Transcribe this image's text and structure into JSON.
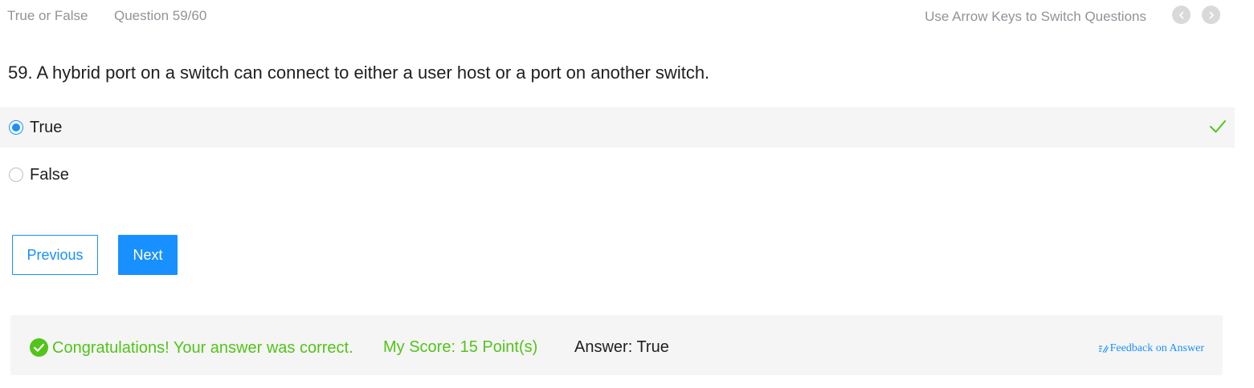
{
  "header": {
    "question_type": "True or False",
    "progress": "Question 59/60",
    "hint": "Use Arrow Keys to Switch Questions",
    "prev_icon": "chevron-left-icon",
    "next_icon": "chevron-right-icon"
  },
  "question": {
    "text": "59. A hybrid port on a switch can connect to either a user host or a port on another switch."
  },
  "options": [
    {
      "label": "True",
      "selected": true,
      "correct": true
    },
    {
      "label": "False",
      "selected": false,
      "correct": false
    }
  ],
  "buttons": {
    "previous": "Previous",
    "next": "Next"
  },
  "result": {
    "message": "Congratulations! Your answer was correct.",
    "score_label": "My Score:",
    "score_value": "15 Point(s)",
    "answer_label": "Answer:",
    "answer_value": "True",
    "feedback": "Feedback on Answer"
  },
  "colors": {
    "accent": "#1890ff",
    "success": "#52c41a",
    "muted_text": "#909399",
    "panel_bg": "#f5f5f5"
  }
}
